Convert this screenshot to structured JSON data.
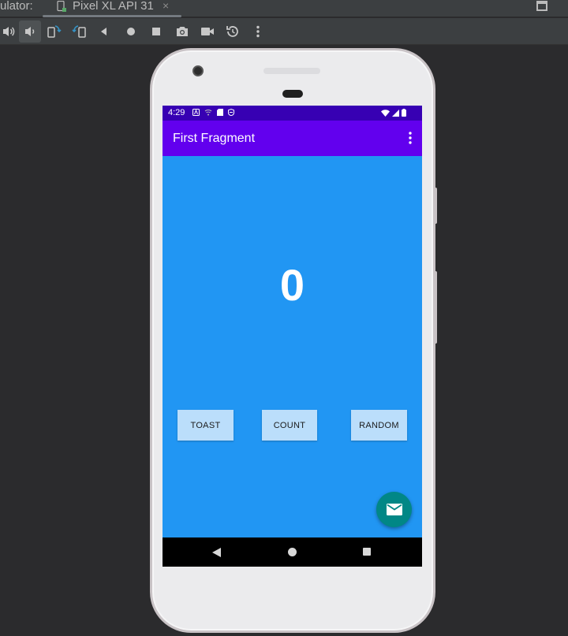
{
  "ide": {
    "panel_prefix": "ulator:",
    "tab_label": "Pixel XL API 31",
    "tab_close": "×",
    "toolbar_icons": [
      "volume-up-icon",
      "volume-down-icon",
      "rotate-left-icon",
      "rotate-right-icon",
      "back-icon",
      "home-icon",
      "overview-icon",
      "screenshot-icon",
      "screen-record-icon",
      "snapshot-icon",
      "more-icon"
    ],
    "active_tool": "volume-down-icon"
  },
  "device": {
    "status_time": "4:29",
    "app_title": "First Fragment",
    "counter_value": "0",
    "buttons": {
      "toast": "TOAST",
      "count": "COUNT",
      "random": "RANDOM"
    },
    "fab_icon": "email-icon",
    "colors": {
      "status_bar": "#3700b3",
      "app_bar": "#6200ee",
      "background": "#2196f3",
      "button": "#bbdefb",
      "fab": "#018786"
    }
  }
}
